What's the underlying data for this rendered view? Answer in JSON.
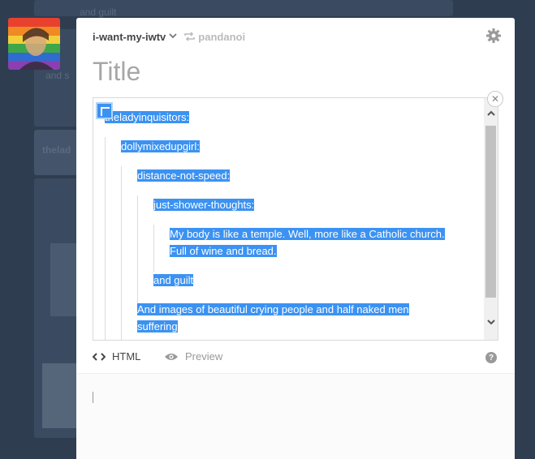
{
  "background": {
    "snippets": [
      "and guilt",
      "and s",
      "thelad"
    ]
  },
  "header": {
    "blog_name": "i-want-my-iwtv",
    "reblogged_from": "pandanoi"
  },
  "title_placeholder": "Title",
  "quote": {
    "l0": "theladyinquisitors:",
    "l1": "dollymixedupgirl:",
    "l2": "distance-not-speed:",
    "l3": "just-shower-thoughts:",
    "l4a": "My body is like a temple. Well, more like a Catholic church.",
    "l4b": "Full of wine and bread.",
    "l3b": "and guilt",
    "l2a": "And images of beautiful crying people and half naked men",
    "l2b": "suffering"
  },
  "tabs": {
    "html": "HTML",
    "preview": "Preview"
  },
  "colors": {
    "selection": "#3b92f2",
    "dashboard": "#36465d"
  }
}
